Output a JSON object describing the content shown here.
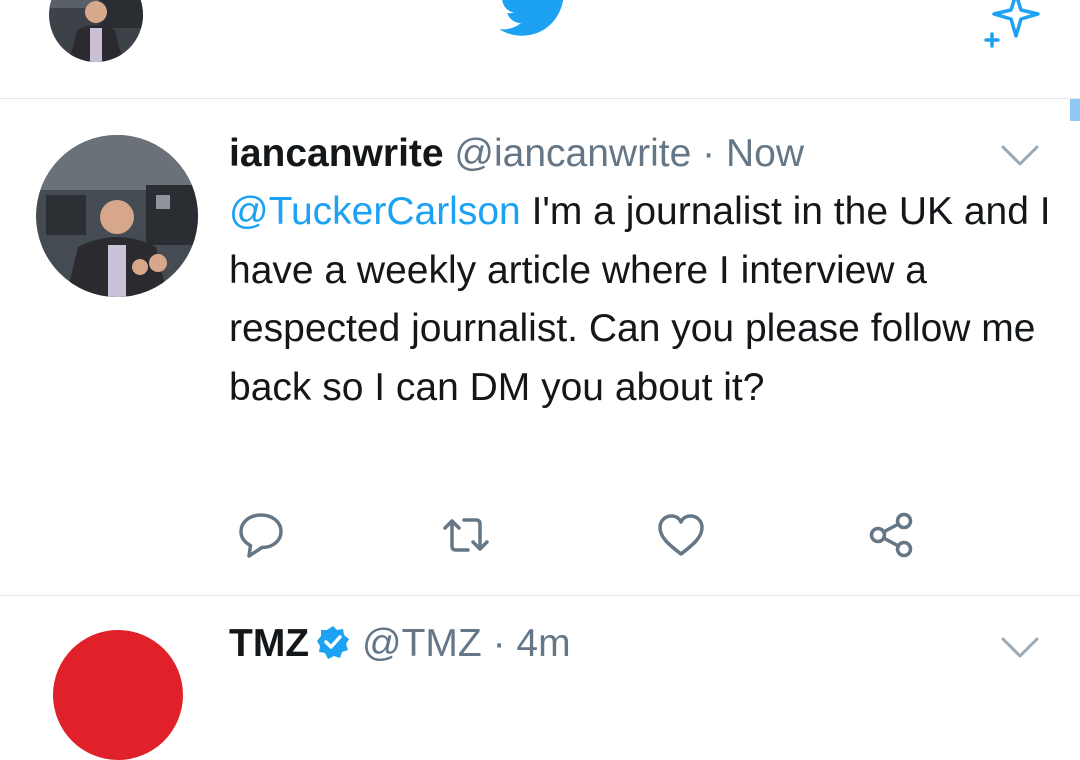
{
  "top_bar": {
    "logo_icon": "twitter-bird-icon",
    "sparkle_icon": "sparkle-icon",
    "brand_color": "#1da1f2"
  },
  "tweet": {
    "display_name": "iancanwrite",
    "handle": "@iancanwrite",
    "separator": "·",
    "time": "Now",
    "mention": "@TuckerCarlson",
    "text": " I'm a journalist in the UK and I have a weekly article where I interview a respected journalist. Can you please follow me back so I can DM you about it?",
    "actions": [
      "reply-icon",
      "retweet-icon",
      "like-icon",
      "share-icon"
    ]
  },
  "next_tweet": {
    "display_name": "TMZ",
    "handle": "@TMZ",
    "separator": "·",
    "time": "4m"
  }
}
